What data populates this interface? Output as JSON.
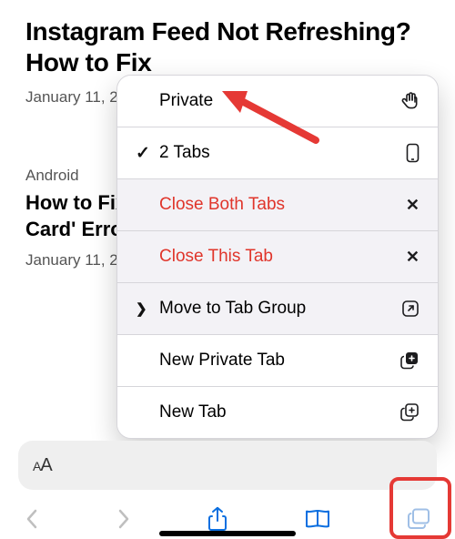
{
  "article1": {
    "title": "Instagram Feed Not Refreshing? How to Fix",
    "date": "January 11, 202"
  },
  "article2": {
    "category": "Android",
    "title_line1": "How to Fix tl",
    "title_line2": "Card' Error o",
    "date": "January 11, 202"
  },
  "menu": {
    "private": "Private",
    "tabs": "2 Tabs",
    "close_both": "Close Both Tabs",
    "close_this": "Close This Tab",
    "move_group": "Move to Tab Group",
    "new_private": "New Private Tab",
    "new_tab": "New Tab"
  },
  "urlbar": {
    "aa_small": "A",
    "aa_large": "A"
  }
}
